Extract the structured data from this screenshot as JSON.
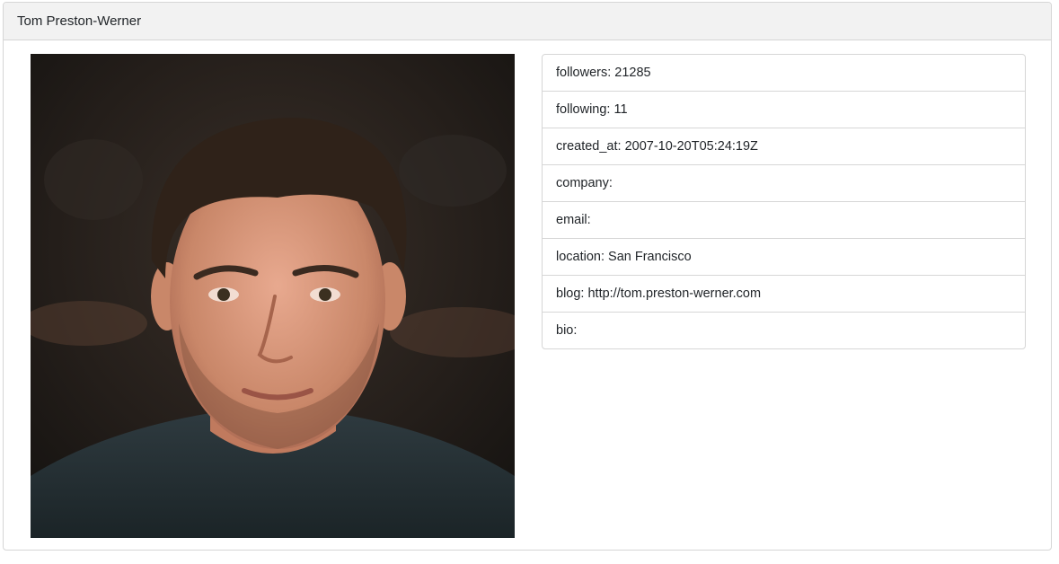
{
  "profile": {
    "name": "Tom Preston-Werner",
    "details": [
      {
        "key": "followers",
        "text": "followers: 21285"
      },
      {
        "key": "following",
        "text": "following: 11"
      },
      {
        "key": "created-at",
        "text": "created_at: 2007-10-20T05:24:19Z"
      },
      {
        "key": "company",
        "text": "company:"
      },
      {
        "key": "email",
        "text": "email:"
      },
      {
        "key": "location",
        "text": "location: San Francisco"
      },
      {
        "key": "blog",
        "text": "blog: http://tom.preston-werner.com"
      },
      {
        "key": "bio",
        "text": "bio:"
      }
    ]
  },
  "colors": {
    "header_bg": "#f2f2f2",
    "border": "#d6d6d6",
    "text": "#212529"
  }
}
